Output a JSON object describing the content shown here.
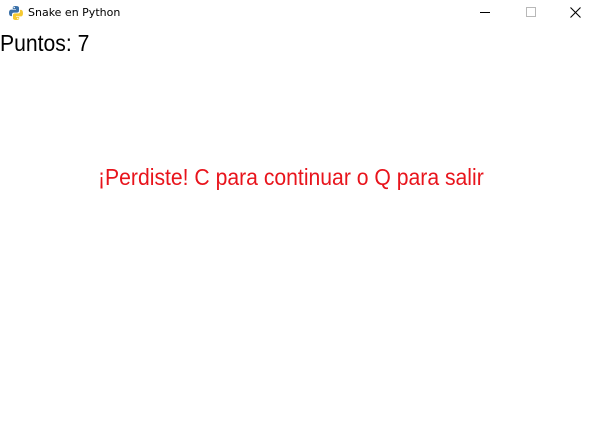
{
  "window": {
    "title": "Snake en Python",
    "icon": "python-icon"
  },
  "game": {
    "score_text": "Puntos: 7",
    "message": "¡Perdiste! C para continuar o Q para salir",
    "message_color": "#e8141c",
    "score_color": "#000000",
    "background_color": "#ffffff"
  }
}
